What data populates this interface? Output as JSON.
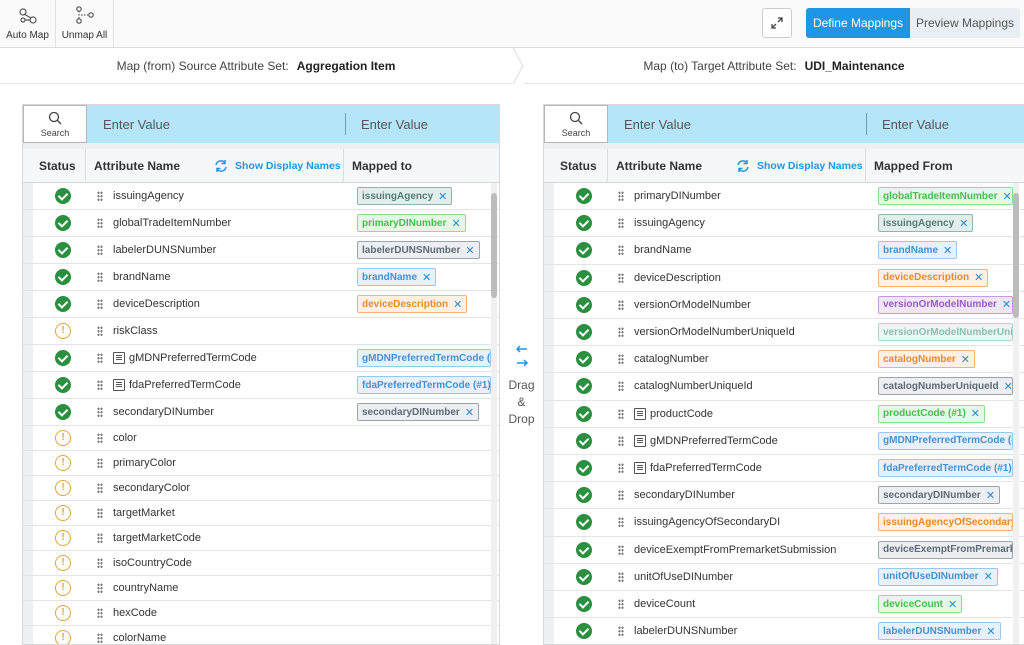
{
  "toolbar": {
    "auto_map_label": "Auto Map",
    "unmap_all_label": "Unmap All",
    "define_mappings_label": "Define Mappings",
    "preview_mappings_label": "Preview Mappings",
    "accent_color": "#1e96e6"
  },
  "source_header": {
    "label": "Map (from) Source Attribute Set:",
    "value": "Aggregation Item"
  },
  "target_header": {
    "label": "Map (to) Target Attribute Set:",
    "value": "UDI_Maintenance"
  },
  "left": {
    "search_label": "Search",
    "search_placeholder_1": "Enter Value",
    "search_placeholder_2": "Enter Value",
    "col_status": "Status",
    "col_attribute": "Attribute Name",
    "show_display_names": "Show Display Names",
    "col_mapped": "Mapped to",
    "rows": [
      {
        "status": "ok",
        "name": "issuingAgency",
        "doc": false,
        "tag": "issuingAgency",
        "color": "teal"
      },
      {
        "status": "ok",
        "name": "globalTradeItemNumber",
        "doc": false,
        "tag": "primaryDINumber",
        "color": "green"
      },
      {
        "status": "ok",
        "name": "labelerDUNSNumber",
        "doc": false,
        "tag": "labelerDUNSNumber",
        "color": "slate"
      },
      {
        "status": "ok",
        "name": "brandName",
        "doc": false,
        "tag": "brandName",
        "color": "blue"
      },
      {
        "status": "ok",
        "name": "deviceDescription",
        "doc": false,
        "tag": "deviceDescription",
        "color": "orange"
      },
      {
        "status": "warn",
        "name": "riskClass",
        "doc": false,
        "tag": "",
        "color": ""
      },
      {
        "status": "ok",
        "name": "gMDNPreferredTermCode",
        "doc": true,
        "tag": "gMDNPreferredTermCode (#",
        "color": "blue"
      },
      {
        "status": "ok",
        "name": "fdaPreferredTermCode",
        "doc": true,
        "tag": "fdaPreferredTermCode (#1)",
        "color": "blue"
      },
      {
        "status": "ok",
        "name": "secondaryDINumber",
        "doc": false,
        "tag": "secondaryDINumber",
        "color": "slate"
      },
      {
        "status": "warn",
        "name": "color",
        "doc": false,
        "tag": "",
        "color": ""
      },
      {
        "status": "warn",
        "name": "primaryColor",
        "doc": false,
        "tag": "",
        "color": ""
      },
      {
        "status": "warn",
        "name": "secondaryColor",
        "doc": false,
        "tag": "",
        "color": ""
      },
      {
        "status": "warn",
        "name": "targetMarket",
        "doc": false,
        "tag": "",
        "color": ""
      },
      {
        "status": "warn",
        "name": "targetMarketCode",
        "doc": false,
        "tag": "",
        "color": ""
      },
      {
        "status": "warn",
        "name": "isoCountryCode",
        "doc": false,
        "tag": "",
        "color": ""
      },
      {
        "status": "warn",
        "name": "countryName",
        "doc": false,
        "tag": "",
        "color": ""
      },
      {
        "status": "warn",
        "name": "hexCode",
        "doc": false,
        "tag": "",
        "color": ""
      },
      {
        "status": "warn",
        "name": "colorName",
        "doc": false,
        "tag": "",
        "color": ""
      }
    ]
  },
  "middle": {
    "line1": "Drag",
    "line2": "&",
    "line3": "Drop"
  },
  "right": {
    "search_label": "Search",
    "search_placeholder_1": "Enter Value",
    "search_placeholder_2": "Enter Value",
    "col_status": "Status",
    "col_attribute": "Attribute Name",
    "show_display_names": "Show Display Names",
    "col_mapped": "Mapped From",
    "rows": [
      {
        "status": "ok",
        "name": "primaryDINumber",
        "doc": false,
        "tag": "globalTradeItemNumber",
        "color": "green"
      },
      {
        "status": "ok",
        "name": "issuingAgency",
        "doc": false,
        "tag": "issuingAgency",
        "color": "teal"
      },
      {
        "status": "ok",
        "name": "brandName",
        "doc": false,
        "tag": "brandName",
        "color": "blue"
      },
      {
        "status": "ok",
        "name": "deviceDescription",
        "doc": false,
        "tag": "deviceDescription",
        "color": "orange"
      },
      {
        "status": "ok",
        "name": "versionOrModelNumber",
        "doc": false,
        "tag": "versionOrModelNumber",
        "color": "purple"
      },
      {
        "status": "ok",
        "name": "versionOrModelNumberUniqueId",
        "doc": false,
        "tag": "versionOrModelNumberUniq",
        "color": "mint"
      },
      {
        "status": "ok",
        "name": "catalogNumber",
        "doc": false,
        "tag": "catalogNumber",
        "color": "orange"
      },
      {
        "status": "ok",
        "name": "catalogNumberUniqueId",
        "doc": false,
        "tag": "catalogNumberUniqueId",
        "color": "slate"
      },
      {
        "status": "ok",
        "name": "productCode",
        "doc": true,
        "tag": "productCode (#1)",
        "color": "green"
      },
      {
        "status": "ok",
        "name": "gMDNPreferredTermCode",
        "doc": true,
        "tag": "gMDNPreferredTermCode (#",
        "color": "blue"
      },
      {
        "status": "ok",
        "name": "fdaPreferredTermCode",
        "doc": true,
        "tag": "fdaPreferredTermCode (#1)",
        "color": "blue"
      },
      {
        "status": "ok",
        "name": "secondaryDINumber",
        "doc": false,
        "tag": "secondaryDINumber",
        "color": "slate"
      },
      {
        "status": "ok",
        "name": "issuingAgencyOfSecondaryDI",
        "doc": false,
        "tag": "issuingAgencyOfSecondaryI",
        "color": "orange"
      },
      {
        "status": "ok",
        "name": "deviceExemptFromPremarketSubmission",
        "doc": false,
        "tag": "deviceExemptFromPremarke",
        "color": "slate"
      },
      {
        "status": "ok",
        "name": "unitOfUseDINumber",
        "doc": false,
        "tag": "unitOfUseDINumber",
        "color": "blue"
      },
      {
        "status": "ok",
        "name": "deviceCount",
        "doc": false,
        "tag": "deviceCount",
        "color": "green"
      },
      {
        "status": "ok",
        "name": "labelerDUNSNumber",
        "doc": false,
        "tag": "labelerDUNSNumber",
        "color": "blue"
      }
    ]
  }
}
